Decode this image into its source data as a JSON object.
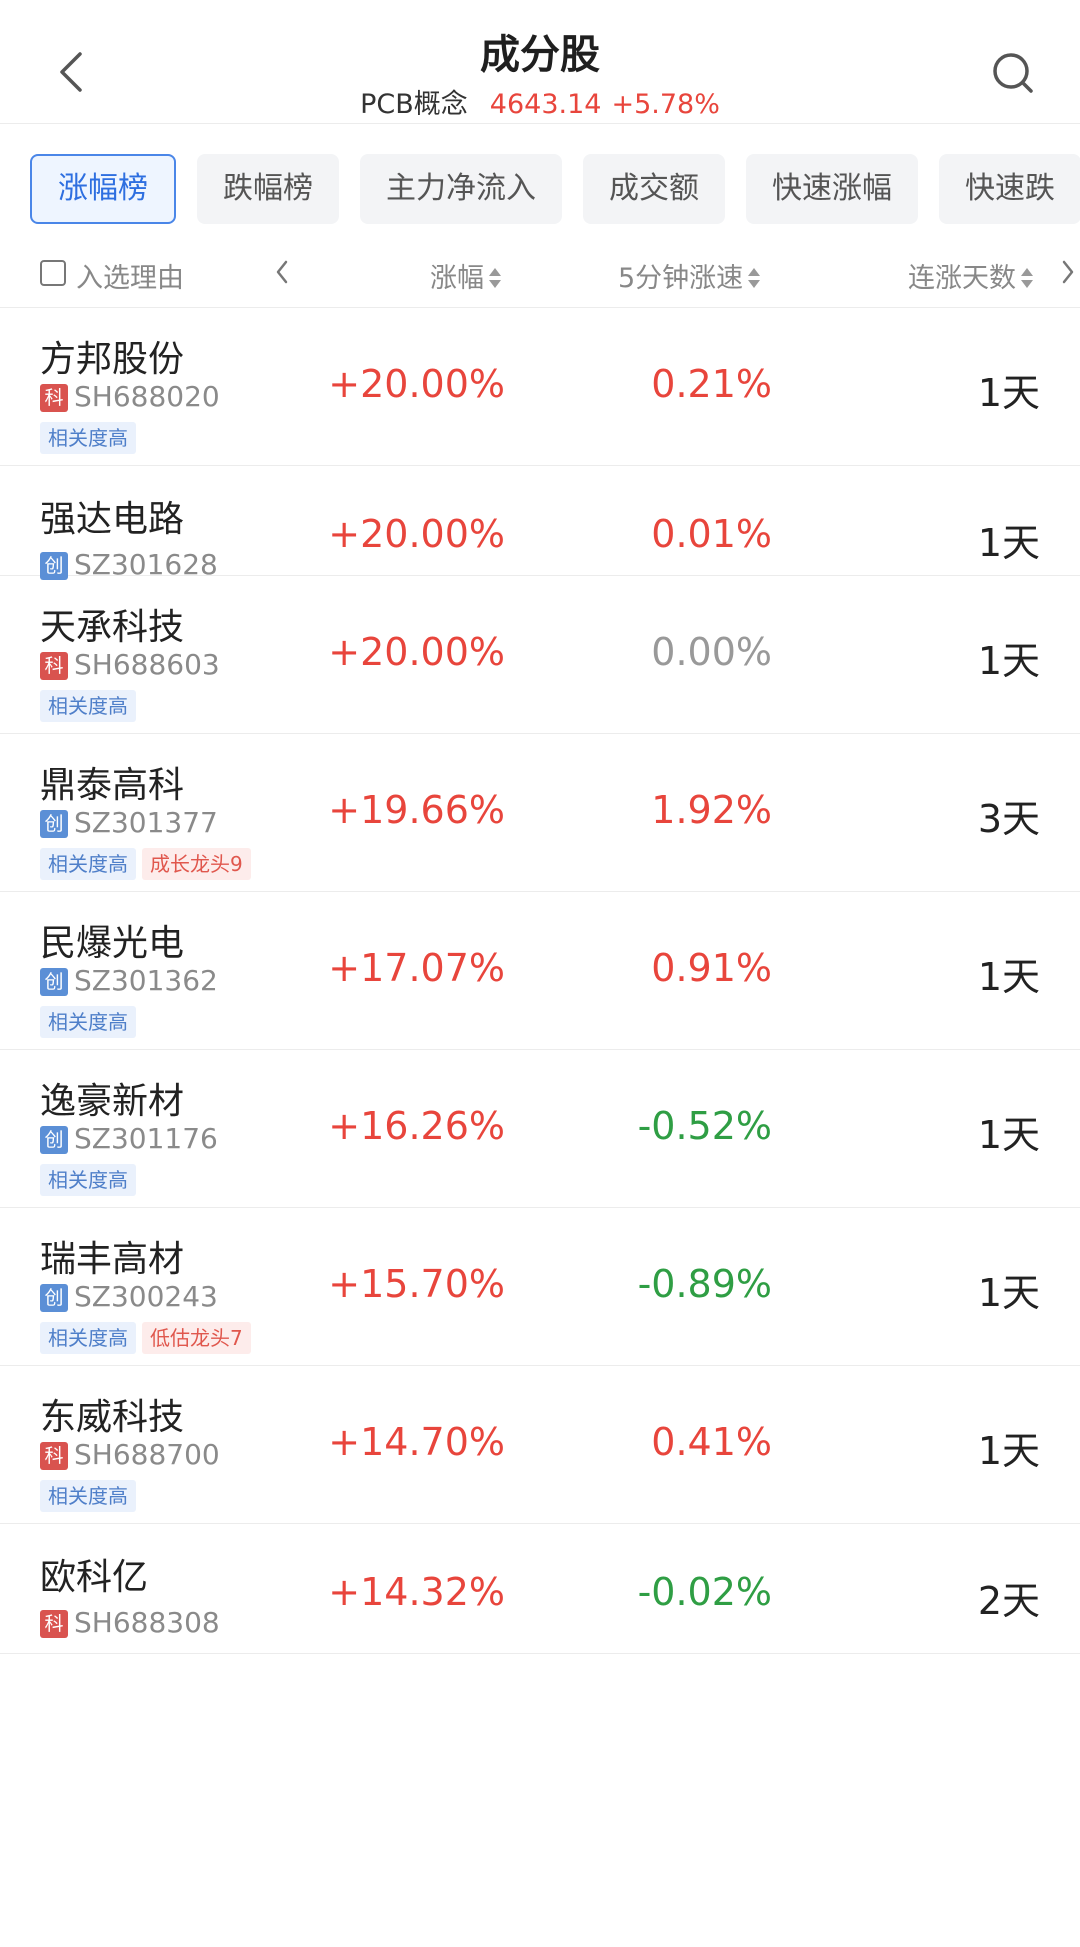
{
  "header": {
    "title": "成分股",
    "concept_name": "PCB概念",
    "index_value": "4643.14",
    "index_change": "+5.78%"
  },
  "tabs": [
    "涨幅榜",
    "跌幅榜",
    "主力净流入",
    "成交额",
    "快速涨幅",
    "快速跌"
  ],
  "active_tab": 0,
  "columns": {
    "reason": "入选理由",
    "change": "涨幅",
    "speed": "5分钟涨速",
    "days": "连涨天数"
  },
  "icons": [
    "back-arrow-icon",
    "search-icon",
    "checkbox-icon",
    "chevron-left-icon",
    "sort-icon",
    "chevron-right-icon"
  ],
  "colors": {
    "up": "#e8453c",
    "down": "#2f9e44",
    "flat": "#999999",
    "accent": "#2e6fe0",
    "badge_ke": "#d9534f",
    "badge_chuang": "#5b8fd6"
  },
  "rows": [
    {
      "name": "方邦股份",
      "board": "科",
      "code": "SH688020",
      "change": "+20.00%",
      "speed": "0.21%",
      "speed_dir": "up",
      "days": "1天",
      "tags": [
        {
          "text": "相关度高",
          "style": "blue"
        }
      ]
    },
    {
      "name": "强达电路",
      "board": "创",
      "code": "SZ301628",
      "change": "+20.00%",
      "speed": "0.01%",
      "speed_dir": "up",
      "days": "1天",
      "tags": []
    },
    {
      "name": "天承科技",
      "board": "科",
      "code": "SH688603",
      "change": "+20.00%",
      "speed": "0.00%",
      "speed_dir": "flat",
      "days": "1天",
      "tags": [
        {
          "text": "相关度高",
          "style": "blue"
        }
      ]
    },
    {
      "name": "鼎泰高科",
      "board": "创",
      "code": "SZ301377",
      "change": "+19.66%",
      "speed": "1.92%",
      "speed_dir": "up",
      "days": "3天",
      "tags": [
        {
          "text": "相关度高",
          "style": "blue"
        },
        {
          "text": "成长龙头9",
          "style": "red"
        }
      ]
    },
    {
      "name": "民爆光电",
      "board": "创",
      "code": "SZ301362",
      "change": "+17.07%",
      "speed": "0.91%",
      "speed_dir": "up",
      "days": "1天",
      "tags": [
        {
          "text": "相关度高",
          "style": "blue"
        }
      ]
    },
    {
      "name": "逸豪新材",
      "board": "创",
      "code": "SZ301176",
      "change": "+16.26%",
      "speed": "-0.52%",
      "speed_dir": "down",
      "days": "1天",
      "tags": [
        {
          "text": "相关度高",
          "style": "blue"
        }
      ]
    },
    {
      "name": "瑞丰高材",
      "board": "创",
      "code": "SZ300243",
      "change": "+15.70%",
      "speed": "-0.89%",
      "speed_dir": "down",
      "days": "1天",
      "tags": [
        {
          "text": "相关度高",
          "style": "blue"
        },
        {
          "text": "低估龙头7",
          "style": "red"
        }
      ]
    },
    {
      "name": "东威科技",
      "board": "科",
      "code": "SH688700",
      "change": "+14.70%",
      "speed": "0.41%",
      "speed_dir": "up",
      "days": "1天",
      "tags": [
        {
          "text": "相关度高",
          "style": "blue"
        }
      ]
    },
    {
      "name": "欧科亿",
      "board": "科",
      "code": "SH688308",
      "change": "+14.32%",
      "speed": "-0.02%",
      "speed_dir": "down",
      "days": "2天",
      "tags": []
    }
  ]
}
